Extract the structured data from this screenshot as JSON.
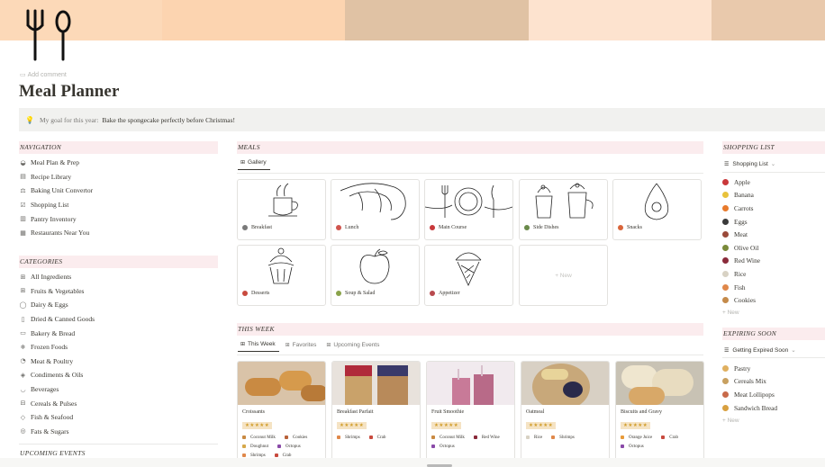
{
  "cover": {
    "colors": [
      "#fcd9b8",
      "#fcd4b0",
      "#e0c2a4",
      "#fde3cf",
      "#e9c9ac"
    ]
  },
  "page": {
    "icon": "fork-spoon-icon",
    "add_comment": "Add comment",
    "title": "Meal Planner"
  },
  "callout": {
    "icon": "lightbulb-icon",
    "label": "My goal for this year:",
    "text": "Bake the spongecake perfectly before Christmas!"
  },
  "navigation": {
    "heading": "NAVIGATION",
    "items": [
      {
        "label": "Meal Plan & Prep",
        "icon": "cloche-icon"
      },
      {
        "label": "Recipe Library",
        "icon": "recipe-book-icon"
      },
      {
        "label": "Baking Unit Convertor",
        "icon": "scale-icon"
      },
      {
        "label": "Shopping List",
        "icon": "checklist-icon"
      },
      {
        "label": "Pantry Inventory",
        "icon": "pantry-icon"
      },
      {
        "label": "Restaurants Near You",
        "icon": "restaurant-icon"
      }
    ]
  },
  "categories": {
    "heading": "CATEGORIES",
    "items": [
      {
        "label": "All Ingredients",
        "icon": "grid-icon"
      },
      {
        "label": "Fruits & Vegetables",
        "icon": "grid-icon"
      },
      {
        "label": "Dairy & Eggs",
        "icon": "dairy-icon"
      },
      {
        "label": "Dried & Canned Goods",
        "icon": "can-icon"
      },
      {
        "label": "Bakery & Bread",
        "icon": "bread-icon"
      },
      {
        "label": "Frozen Foods",
        "icon": "snowflake-icon"
      },
      {
        "label": "Meat & Poultry",
        "icon": "meat-icon"
      },
      {
        "label": "Condiments & Oils",
        "icon": "bottle-icon"
      },
      {
        "label": "Beverages",
        "icon": "cup-icon"
      },
      {
        "label": "Cereals & Pulses",
        "icon": "grain-icon"
      },
      {
        "label": "Fish & Seafood",
        "icon": "fish-icon"
      },
      {
        "label": "Fats & Sugars",
        "icon": "sugar-icon"
      }
    ]
  },
  "upcoming": {
    "heading": "UPCOMING EVENTS"
  },
  "meals": {
    "heading": "MEALS",
    "tab": "Gallery",
    "cards": [
      {
        "label": "Breakfast",
        "icon": "search-icon",
        "color": "#7a7a7a"
      },
      {
        "label": "Lunch",
        "icon": "phone-icon",
        "color": "#d0554e"
      },
      {
        "label": "Main Course",
        "icon": "plate-icon",
        "color": "#c8383a"
      },
      {
        "label": "Side Dishes",
        "icon": "bowl-icon",
        "color": "#6a8a4a"
      },
      {
        "label": "Snacks",
        "icon": "pot-icon",
        "color": "#d9653a"
      },
      {
        "label": "Desserts",
        "icon": "cake-icon",
        "color": "#c84a3e"
      },
      {
        "label": "Soup & Salad",
        "icon": "salad-icon",
        "color": "#8aa34a"
      },
      {
        "label": "Appetizer",
        "icon": "taco-icon",
        "color": "#b84a4e"
      }
    ],
    "new_label": "+ New"
  },
  "this_week": {
    "heading": "THIS WEEK",
    "tabs": [
      "This Week",
      "Favorites",
      "Upcoming Events"
    ],
    "cards": [
      {
        "name": "Croissants",
        "stars": "★★★★★",
        "tags": [
          "Coconut Milk",
          "Cookies",
          "Doughnut",
          "Octopus",
          "Shrimps",
          "Crab"
        ]
      },
      {
        "name": "Breakfast Parfait",
        "stars": "★★★★★",
        "tags": [
          "Shrimps",
          "Crab"
        ]
      },
      {
        "name": "Fruit Smoothie",
        "stars": "★★★★★",
        "tags": [
          "Coconut Milk",
          "Red Wine",
          "Octopus"
        ]
      },
      {
        "name": "Oatmeal",
        "stars": "★★★★★",
        "tags": [
          "Rice",
          "Shrimps"
        ]
      },
      {
        "name": "Biscuits and Gravy",
        "stars": "★★★★★",
        "tags": [
          "Orange Juice",
          "Crab",
          "Octopus"
        ]
      }
    ]
  },
  "shopping": {
    "heading": "SHOPPING LIST",
    "view": "Shopping List",
    "items": [
      {
        "label": "Apple",
        "color": "#c9383a"
      },
      {
        "label": "Banana",
        "color": "#e8c23c"
      },
      {
        "label": "Carrots",
        "color": "#e87a2c"
      },
      {
        "label": "Eggs",
        "color": "#3a3a3a"
      },
      {
        "label": "Meat",
        "color": "#9a4a3a"
      },
      {
        "label": "Olive Oil",
        "color": "#7a8a3a"
      },
      {
        "label": "Red Wine",
        "color": "#8a2a3a"
      },
      {
        "label": "Rice",
        "color": "#d8d2c4"
      },
      {
        "label": "Fish",
        "color": "#e0884a"
      },
      {
        "label": "Cookies",
        "color": "#c48a4a"
      }
    ],
    "new_label": "+ New"
  },
  "expiring": {
    "heading": "EXPIRING SOON",
    "view": "Getting Expired Soon",
    "items": [
      {
        "label": "Pastry",
        "color": "#e0b060"
      },
      {
        "label": "Cereals Mix",
        "color": "#c8a060"
      },
      {
        "label": "Meat Lollipops",
        "color": "#c86a4a"
      },
      {
        "label": "Sandwich Bread",
        "color": "#d8a040"
      }
    ],
    "new_label": "+ New"
  }
}
